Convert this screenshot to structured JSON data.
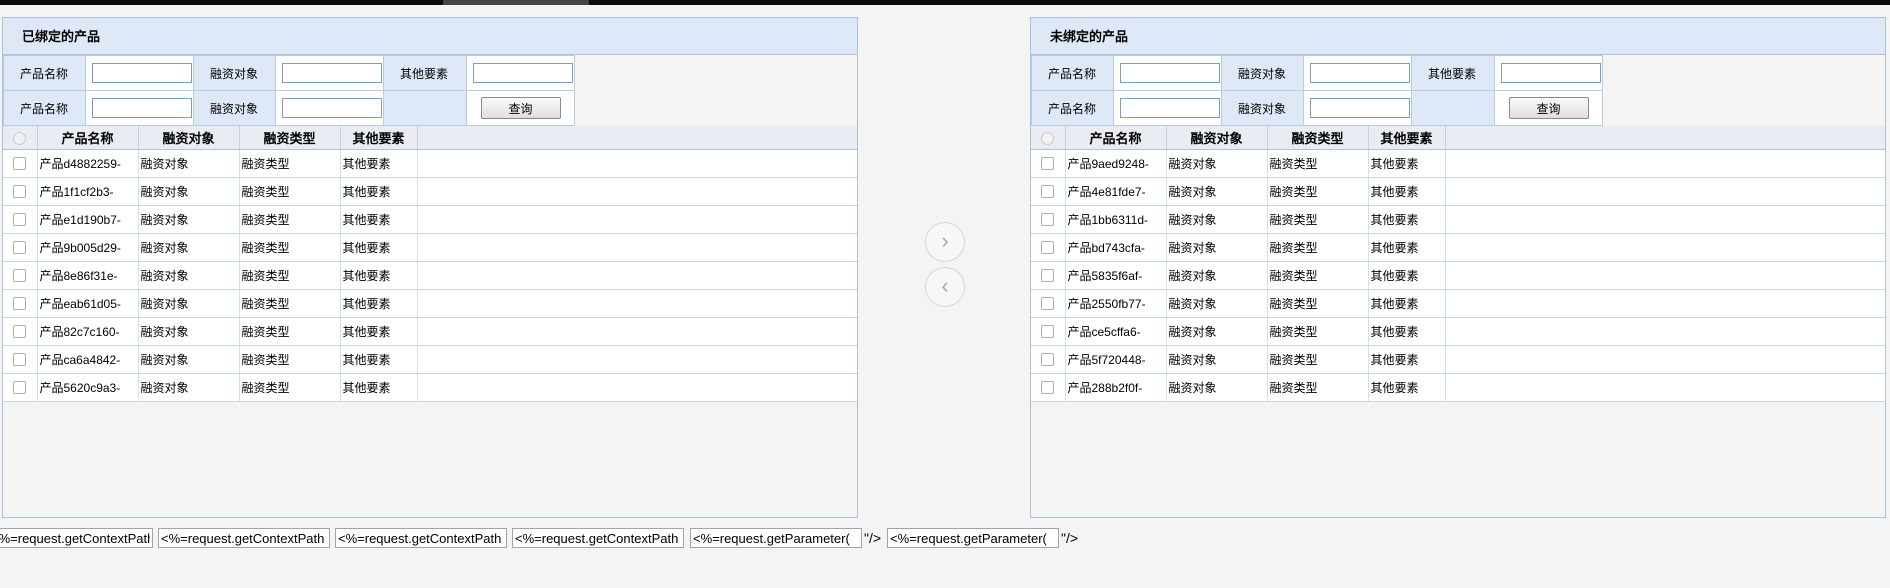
{
  "left_panel": {
    "title": "已绑定的产品",
    "search": {
      "label_product": "产品名称",
      "label_object": "融资对象",
      "label_other": "其他要素",
      "query_button": "查询"
    },
    "grid": {
      "headers": [
        "产品名称",
        "融资对象",
        "融资类型",
        "其他要素"
      ],
      "rows": [
        [
          "产品d4882259-",
          "融资对象",
          "融资类型",
          "其他要素"
        ],
        [
          "产品1f1cf2b3-",
          "融资对象",
          "融资类型",
          "其他要素"
        ],
        [
          "产品e1d190b7-",
          "融资对象",
          "融资类型",
          "其他要素"
        ],
        [
          "产品9b005d29-",
          "融资对象",
          "融资类型",
          "其他要素"
        ],
        [
          "产品8e86f31e-",
          "融资对象",
          "融资类型",
          "其他要素"
        ],
        [
          "产品eab61d05-",
          "融资对象",
          "融资类型",
          "其他要素"
        ],
        [
          "产品82c7c160-",
          "融资对象",
          "融资类型",
          "其他要素"
        ],
        [
          "产品ca6a4842-",
          "融资对象",
          "融资类型",
          "其他要素"
        ],
        [
          "产品5620c9a3-",
          "融资对象",
          "融资类型",
          "其他要素"
        ]
      ]
    }
  },
  "right_panel": {
    "title": "未绑定的产品",
    "search": {
      "label_product": "产品名称",
      "label_object": "融资对象",
      "label_other": "其他要素",
      "query_button": "查询"
    },
    "grid": {
      "headers": [
        "产品名称",
        "融资对象",
        "融资类型",
        "其他要素"
      ],
      "rows": [
        [
          "产品9aed9248-",
          "融资对象",
          "融资类型",
          "其他要素"
        ],
        [
          "产品4e81fde7-",
          "融资对象",
          "融资类型",
          "其他要素"
        ],
        [
          "产品1bb6311d-",
          "融资对象",
          "融资类型",
          "其他要素"
        ],
        [
          "产品bd743cfa-",
          "融资对象",
          "融资类型",
          "其他要素"
        ],
        [
          "产品5835f6af-",
          "融资对象",
          "融资类型",
          "其他要素"
        ],
        [
          "产品2550fb77-",
          "融资对象",
          "融资类型",
          "其他要素"
        ],
        [
          "产品ce5cffa6-",
          "融资对象",
          "融资类型",
          "其他要素"
        ],
        [
          "产品5f720448-",
          "融资对象",
          "融资类型",
          "其他要素"
        ],
        [
          "产品288b2f0f-",
          "融资对象",
          "融资类型",
          "其他要素"
        ]
      ]
    }
  },
  "movers": {
    "bind_icon": "›",
    "unbind_icon": "‹"
  },
  "bottom": {
    "field1": "<%=request.getContextPath",
    "field2": "<%=request.getContextPath",
    "field3": "<%=request.getContextPath",
    "field4": "<%=request.getContextPath",
    "field5": "<%=request.getParameter(",
    "suffix5": "\"/>",
    "field6": "<%=request.getParameter(",
    "suffix6": "\"/>"
  }
}
